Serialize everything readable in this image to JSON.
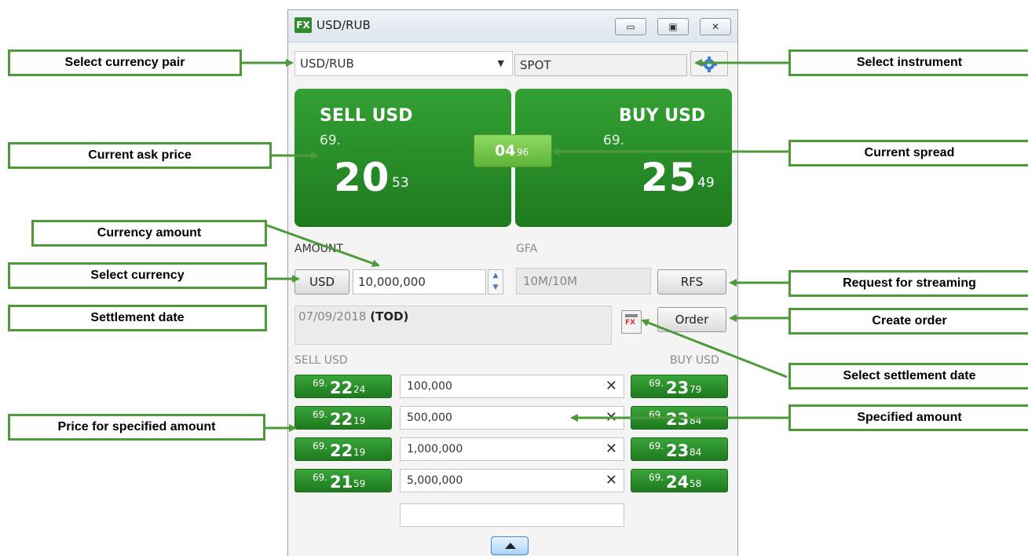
{
  "window": {
    "logo": "FX",
    "title": "USD/RUB",
    "controls": {
      "minimize": "▭",
      "maximize": "▣",
      "close": "✕"
    }
  },
  "selectors": {
    "currency_pair": "USD/RUB",
    "instrument": "SPOT",
    "settings_icon": "gear-icon"
  },
  "sell_tile": {
    "label": "SELL USD",
    "handle": "69.",
    "big": "20",
    "pips": "53"
  },
  "buy_tile": {
    "label": "BUY USD",
    "handle": "69.",
    "big": "25",
    "pips": "49"
  },
  "spread": {
    "big": "04",
    "small": "96"
  },
  "amount": {
    "label": "AMOUNT",
    "currency_button": "USD",
    "value": "10,000,000",
    "gfa_label": "GFA",
    "gfa_value": "10M/10M",
    "rfs_button": "RFS"
  },
  "settlement": {
    "date": "07/09/2018",
    "tenor": "(TOD)",
    "order_button": "Order"
  },
  "ladder": {
    "sell_header": "SELL USD",
    "buy_header": "BUY USD",
    "rows": [
      {
        "sell_pre": "69.",
        "sell_mid": "22",
        "sell_pips": "24",
        "amount": "100,000",
        "buy_pre": "69.",
        "buy_mid": "23",
        "buy_pips": "79"
      },
      {
        "sell_pre": "69.",
        "sell_mid": "22",
        "sell_pips": "19",
        "amount": "500,000",
        "buy_pre": "69.",
        "buy_mid": "23",
        "buy_pips": "84"
      },
      {
        "sell_pre": "69.",
        "sell_mid": "22",
        "sell_pips": "19",
        "amount": "1,000,000",
        "buy_pre": "69.",
        "buy_mid": "23",
        "buy_pips": "84"
      },
      {
        "sell_pre": "69.",
        "sell_mid": "21",
        "sell_pips": "59",
        "amount": "5,000,000",
        "buy_pre": "69.",
        "buy_mid": "24",
        "buy_pips": "58"
      }
    ],
    "clear_icon": "✕"
  },
  "callouts": {
    "select_currency_pair": "Select currency pair",
    "select_instrument": "Select instrument",
    "current_ask_price": "Current ask price",
    "current_spread": "Current spread",
    "currency_amount": "Currency amount",
    "select_currency": "Select currency",
    "request_for_streaming": "Request for streaming",
    "settlement_date": "Settlement date",
    "create_order": "Create order",
    "select_settlement_date": "Select settlement date",
    "specified_amount": "Specified amount",
    "price_for_specified_amount": "Price for specified amount"
  },
  "colors": {
    "tile_green": "#2a8f2a",
    "callout_border": "#4e9a3a",
    "spread_green": "#7ccb50"
  }
}
